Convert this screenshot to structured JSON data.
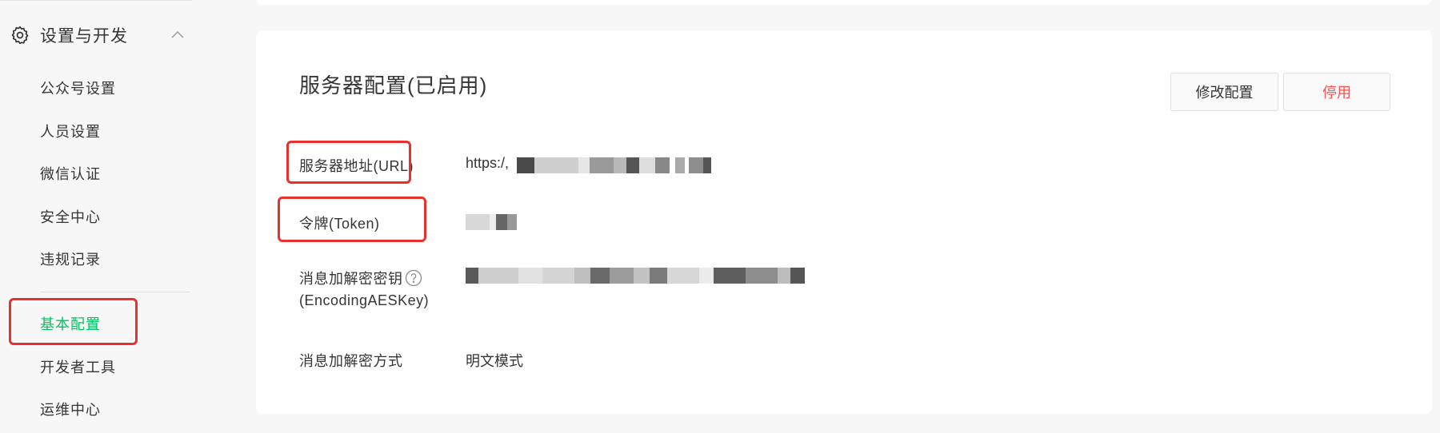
{
  "sidebar": {
    "section_title": "设置与开发",
    "items": [
      {
        "label": "公众号设置"
      },
      {
        "label": "人员设置"
      },
      {
        "label": "微信认证"
      },
      {
        "label": "安全中心"
      },
      {
        "label": "违规记录"
      },
      {
        "label": "基本配置",
        "active": true
      },
      {
        "label": "开发者工具"
      },
      {
        "label": "运维中心"
      }
    ]
  },
  "server_config": {
    "title": "服务器配置(已启用)",
    "modify_button": "修改配置",
    "disable_button": "停用",
    "rows": [
      {
        "label": "服务器地址(URL)",
        "value": "https:/,"
      },
      {
        "label": "令牌(Token)",
        "value": ""
      },
      {
        "label_line1": "消息加解密密钥",
        "label_line2": "(EncodingAESKey)",
        "value": ""
      },
      {
        "label": "消息加解密方式",
        "value": "明文模式"
      }
    ]
  },
  "colors": {
    "accent_green": "#07c160",
    "danger_red": "#fa5151",
    "highlight_box": "#e8302d"
  },
  "icons": {
    "section": "gear-icon",
    "collapse": "chevron-up-icon",
    "help": "question-circle-icon"
  }
}
